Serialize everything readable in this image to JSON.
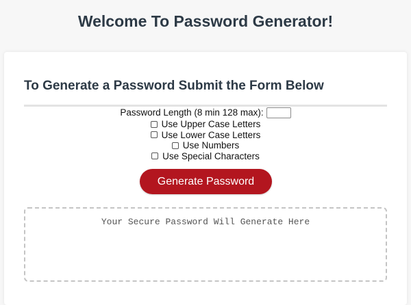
{
  "page": {
    "title": "Welcome To Password Generator!"
  },
  "card": {
    "header": "To Generate a Password Submit the Form Below"
  },
  "form": {
    "length_label": "Password Length (8 min 128 max):",
    "length_value": "",
    "options": [
      {
        "label": "Use Upper Case Letters",
        "checked": false
      },
      {
        "label": "Use Lower Case Letters",
        "checked": false
      },
      {
        "label": "Use Numbers",
        "checked": false
      },
      {
        "label": "Use Special Characters",
        "checked": false
      }
    ],
    "generate_label": "Generate Password"
  },
  "output": {
    "placeholder": "Your Secure Password Will Generate Here",
    "value": ""
  },
  "colors": {
    "background": "#f7f7f7",
    "card": "#ffffff",
    "accent": "#b3161f",
    "heading": "#2d3a46"
  }
}
